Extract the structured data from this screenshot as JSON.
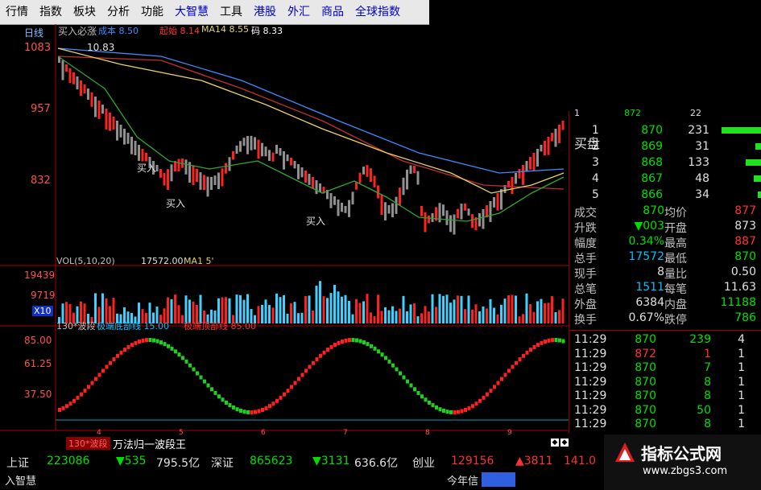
{
  "menu": [
    "行情",
    "指数",
    "板块",
    "分析",
    "功能",
    "大智慧",
    "工具",
    "港股",
    "外汇",
    "商品",
    "全球指数"
  ],
  "colors": {
    "up": "#ff3030",
    "down": "#00e000",
    "bg": "#000000",
    "ma_blue": "#3d8bff",
    "ma_yellow": "#e6d36a",
    "ma_red": "#c03030",
    "ma_green": "#2ea82e"
  },
  "kline": {
    "period_label": "日线",
    "indicator_name": "买入必涨",
    "legend": [
      {
        "label": "成本 8.50",
        "color": "#3d8bff"
      },
      {
        "label": "起始 8.14",
        "color": "#ff3030"
      },
      {
        "label": "MA14 8.55",
        "color": "#e6d36a"
      },
      {
        "label": "码 8.33",
        "color": "#ffffff"
      }
    ],
    "ylabels": [
      "1083",
      "957",
      "832"
    ],
    "peak_label": "10.83",
    "buy_labels": [
      "买入",
      "买入",
      "买入"
    ]
  },
  "volume": {
    "header": "VOL(5,10,20)",
    "value": "17572.00",
    "ma1": "MA1 5'",
    "ylabels": [
      "19439",
      "9719"
    ],
    "unit": "X10"
  },
  "wave": {
    "header": "130*波段",
    "line1": "极端底部线 15.00",
    "line2": "极端顶部线 85.00",
    "ylabels": [
      "85.00",
      "61.25",
      "37.50"
    ],
    "bottom_tabs": [
      "130*波段",
      "万法归一波段王"
    ],
    "x_ticks": [
      "4",
      "5",
      "6",
      "7",
      "8",
      "9"
    ]
  },
  "orderbook": {
    "buy_label": "买盘",
    "rows": [
      {
        "level": "1",
        "price": "870",
        "vol": "231"
      },
      {
        "level": "2",
        "price": "869",
        "vol": "31"
      },
      {
        "level": "3",
        "price": "868",
        "vol": "133"
      },
      {
        "level": "4",
        "price": "867",
        "vol": "48"
      },
      {
        "level": "5",
        "price": "866",
        "vol": "34"
      }
    ],
    "top_partial": {
      "level": "1",
      "price": "872",
      "vol": "22"
    }
  },
  "stats": [
    {
      "k1": "成交",
      "v1": "870",
      "k2": "均价",
      "v2": "877"
    },
    {
      "k1": "升跌",
      "v1": "▼003",
      "k2": "开盘",
      "v2": "873"
    },
    {
      "k1": "幅度",
      "v1": "0.34%",
      "k2": "最高",
      "v2": "887"
    },
    {
      "k1": "总手",
      "v1": "17572",
      "k2": "最低",
      "v2": "870"
    },
    {
      "k1": "现手",
      "v1": "8",
      "k2": "量比",
      "v2": "0.50"
    },
    {
      "k1": "总笔",
      "v1": "1511",
      "k2": "每笔",
      "v2": "11.63"
    },
    {
      "k1": "外盘",
      "v1": "6384",
      "k2": "内盘",
      "v2": "11188"
    },
    {
      "k1": "换手",
      "v1": "0.67%",
      "k2": "跌停",
      "v2": "786"
    }
  ],
  "ticks": [
    {
      "time": "11:29",
      "price": "870",
      "vol": "239",
      "n": "4"
    },
    {
      "time": "11:29",
      "price": "872",
      "vol": "1",
      "n": "1"
    },
    {
      "time": "11:29",
      "price": "870",
      "vol": "7",
      "n": "1"
    },
    {
      "time": "11:29",
      "price": "870",
      "vol": "8",
      "n": "1"
    },
    {
      "time": "11:29",
      "price": "870",
      "vol": "8",
      "n": "1"
    },
    {
      "time": "11:29",
      "price": "870",
      "vol": "50",
      "n": "1"
    },
    {
      "time": "11:29",
      "price": "870",
      "vol": "8",
      "n": "1"
    }
  ],
  "ticker": {
    "sh_label": "上证",
    "sh_value": "223086",
    "sh_change": "▼535",
    "sh_amount": "795.5亿",
    "sz_label": "深证",
    "sz_value": "865623",
    "sz_change": "▼3131",
    "sz_amount": "636.6亿",
    "cy_label": "创业",
    "cy_value": "129156",
    "cy_change": "▲3811",
    "cy_extra": "141.0",
    "bottom_left": "入智慧",
    "bottom_mid": "今年信"
  },
  "watermark": {
    "title": "指标公式网",
    "url": "www.zbgs3.com"
  }
}
